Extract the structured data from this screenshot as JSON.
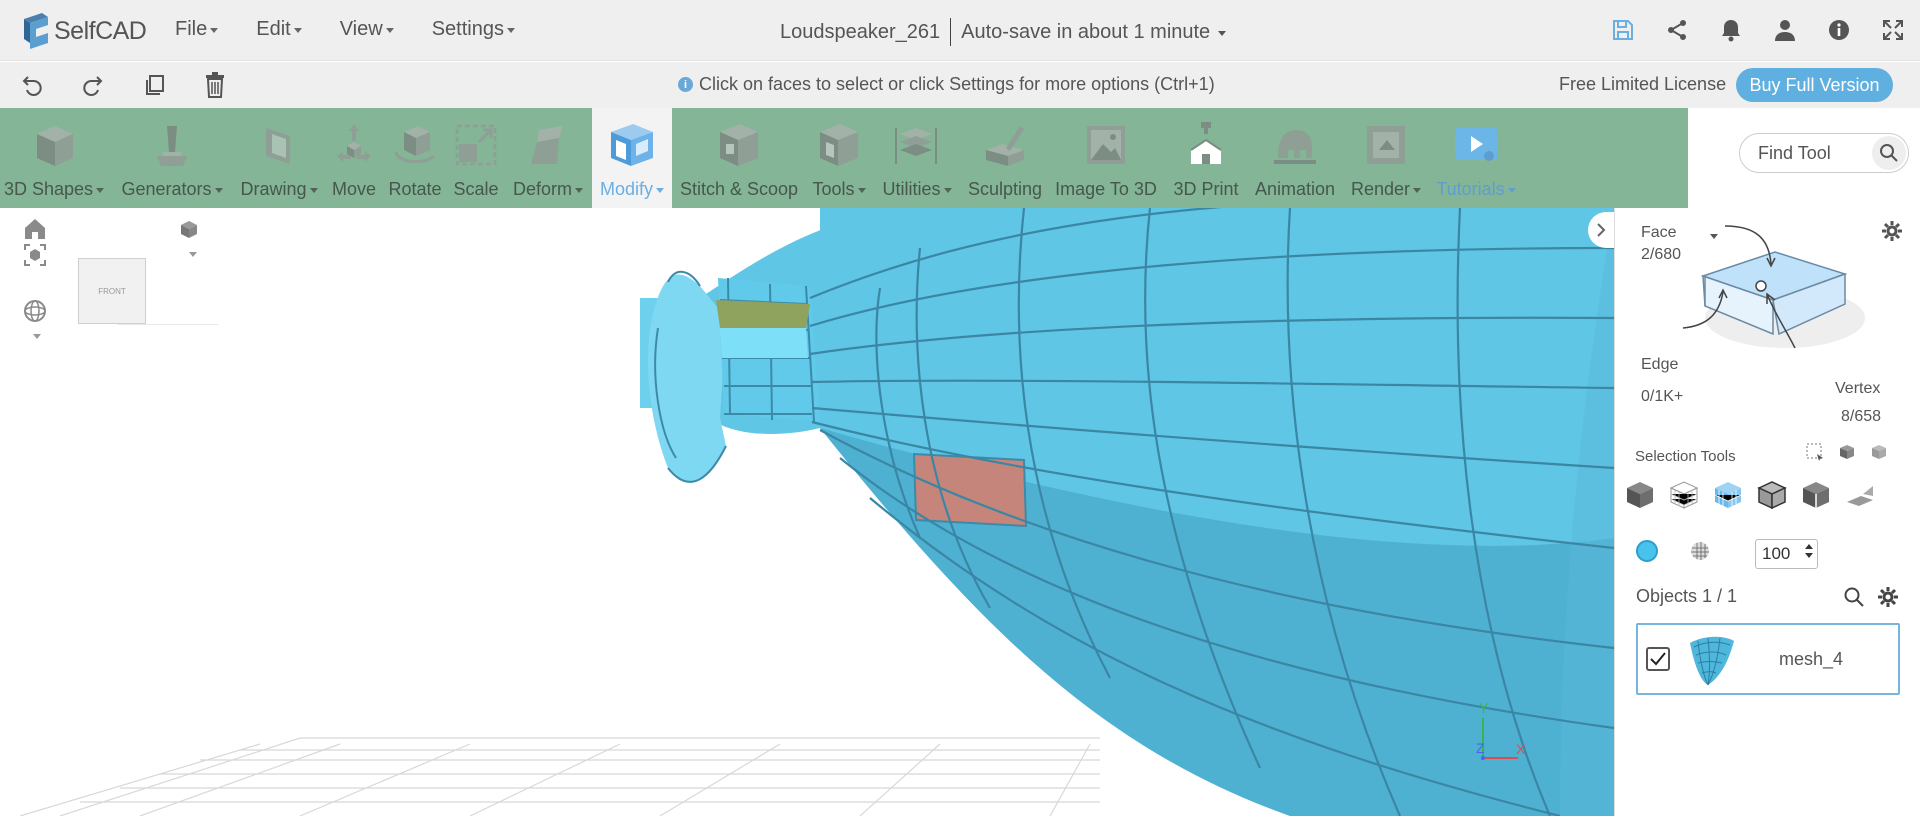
{
  "app": {
    "name": "SelfCAD"
  },
  "menu": [
    {
      "label": "File"
    },
    {
      "label": "Edit"
    },
    {
      "label": "View"
    },
    {
      "label": "Settings"
    }
  ],
  "document": {
    "title": "Loudspeaker_261",
    "autosave": "Auto-save in about 1 minute"
  },
  "hint": {
    "text": "Click on faces to select or click Settings for more options (Ctrl+1)",
    "info_glyph": "i"
  },
  "license": {
    "label": "Free Limited License",
    "buy_label": "Buy Full Version"
  },
  "ribbon": {
    "tools": [
      {
        "label": "3D Shapes",
        "dropdown": true
      },
      {
        "label": "Generators",
        "dropdown": true
      },
      {
        "label": "Drawing",
        "dropdown": true
      },
      {
        "label": "Move",
        "dropdown": false
      },
      {
        "label": "Rotate",
        "dropdown": false
      },
      {
        "label": "Scale",
        "dropdown": false
      },
      {
        "label": "Deform",
        "dropdown": true
      },
      {
        "label": "Modify",
        "dropdown": true,
        "active": true
      },
      {
        "label": "Stitch & Scoop",
        "dropdown": false
      },
      {
        "label": "Tools",
        "dropdown": true
      },
      {
        "label": "Utilities",
        "dropdown": true
      },
      {
        "label": "Sculpting",
        "dropdown": false
      },
      {
        "label": "Image To 3D",
        "dropdown": false
      },
      {
        "label": "3D Print",
        "dropdown": false
      },
      {
        "label": "Animation",
        "dropdown": false
      },
      {
        "label": "Render",
        "dropdown": true
      },
      {
        "label": "Tutorials",
        "dropdown": true
      }
    ],
    "find_placeholder": "Find Tool"
  },
  "viewport": {
    "view_cube_label": "FRONT",
    "axes": {
      "x": "X",
      "y": "Y",
      "z": "Z"
    }
  },
  "selection": {
    "face_label": "Face",
    "face_count": "2/680",
    "edge_label": "Edge",
    "edge_count": "0/1K+",
    "vertex_label": "Vertex",
    "vertex_count": "8/658",
    "tools_label": "Selection Tools",
    "opacity_value": "100"
  },
  "objects": {
    "label": "Objects 1 / 1",
    "items": [
      {
        "name": "mesh_4",
        "checked": true
      }
    ]
  },
  "colors": {
    "ribbon": "#83b596",
    "mesh": "#5fc6e6",
    "selected_face": "#c5857a",
    "accent": "#5fb0e0"
  }
}
